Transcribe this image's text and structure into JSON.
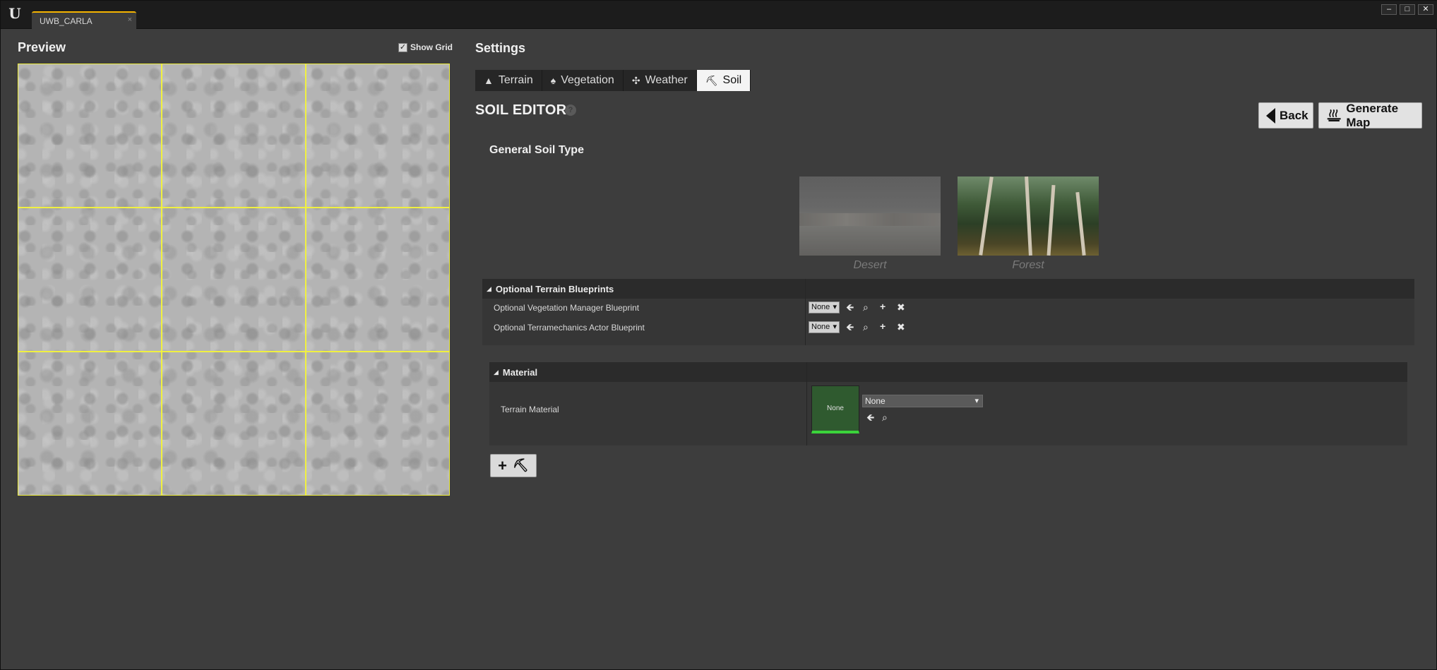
{
  "window": {
    "tab_title": "UWB_CARLA",
    "tab_close": "×",
    "logo_text": "U",
    "buttons": {
      "minimize": "–",
      "maximize": "□",
      "close": "✕"
    }
  },
  "preview": {
    "title": "Preview",
    "show_grid_label": "Show Grid",
    "show_grid_checked": "✓",
    "grid_color": "#f0f040"
  },
  "settings": {
    "title": "Settings",
    "tabs": [
      {
        "label": "Terrain",
        "icon": "mountain-icon",
        "glyph": "▲"
      },
      {
        "label": "Vegetation",
        "icon": "tree-icon",
        "glyph": "♠"
      },
      {
        "label": "Weather",
        "icon": "weather-icon",
        "glyph": "✣"
      },
      {
        "label": "Soil",
        "icon": "shovel-icon",
        "glyph": "⛏"
      }
    ],
    "active_tab": "Soil"
  },
  "soil_editor": {
    "title": "SOIL EDITOR",
    "help": "?",
    "back_label": "Back",
    "generate_label": "Generate Map",
    "general_soil_type_label": "General Soil Type",
    "soil_types": [
      {
        "name": "Desert",
        "selected": false
      },
      {
        "name": "Forest",
        "selected": true
      }
    ],
    "optional_blueprints": {
      "header": "Optional Terrain Blueprints",
      "rows": [
        {
          "label": "Optional Vegetation Manager Blueprint",
          "value": "None"
        },
        {
          "label": "Optional Terramechanics Actor Blueprint",
          "value": "None"
        }
      ]
    },
    "material": {
      "header": "Material",
      "row_label": "Terrain Material",
      "thumb_label": "None",
      "combo_value": "None"
    },
    "add_button_glyph": "+"
  }
}
